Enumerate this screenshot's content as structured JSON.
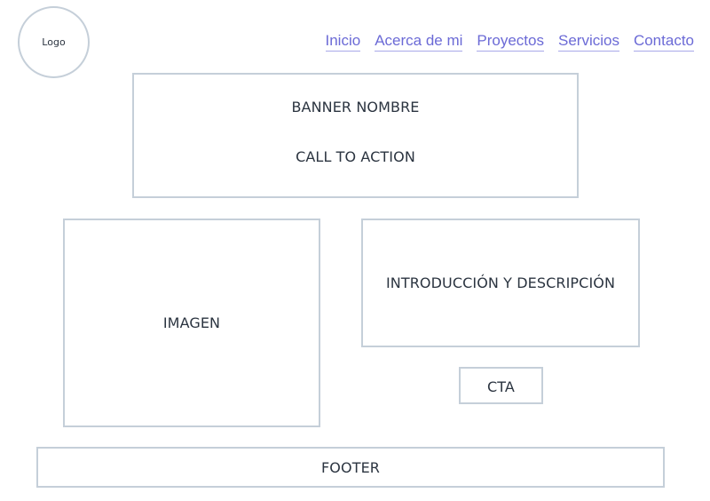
{
  "logo": {
    "label": "Logo"
  },
  "nav": {
    "items": [
      {
        "label": "Inicio"
      },
      {
        "label": "Acerca de mi"
      },
      {
        "label": "Proyectos"
      },
      {
        "label": "Servicios"
      },
      {
        "label": "Contacto"
      }
    ]
  },
  "banner": {
    "name": "BANNER NOMBRE",
    "cta": "CALL TO ACTION"
  },
  "image": {
    "label": "IMAGEN"
  },
  "intro": {
    "label": "INTRODUCCIÓN Y DESCRIPCIÓN"
  },
  "cta": {
    "label": "CTA"
  },
  "footer": {
    "label": "FOOTER"
  }
}
